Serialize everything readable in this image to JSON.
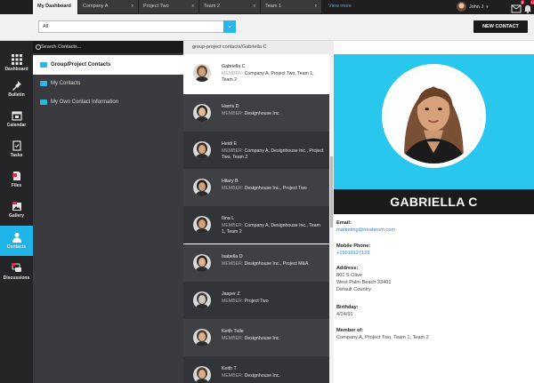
{
  "tabs": [
    {
      "label": "My Dashboard",
      "active": true
    },
    {
      "label": "Company A",
      "active": false
    },
    {
      "label": "Project Two",
      "active": false
    },
    {
      "label": "Team 2",
      "active": false
    },
    {
      "label": "Team 1",
      "active": false
    }
  ],
  "tab_close": "x",
  "view_more": "View more",
  "user_name": "John J",
  "mail_badge": "8",
  "notif_badge": "10",
  "filter_value": "All",
  "new_contact_label": "NEW CONTACT",
  "sidebar": [
    {
      "label": "Dashboard",
      "icon": "grid-icon"
    },
    {
      "label": "Bulletin",
      "icon": "pin-icon"
    },
    {
      "label": "Calendar",
      "icon": "calendar-icon"
    },
    {
      "label": "Tasks",
      "icon": "checklist-icon"
    },
    {
      "label": "Files",
      "icon": "file-icon"
    },
    {
      "label": "Gallery",
      "icon": "image-icon"
    },
    {
      "label": "Contacts",
      "icon": "person-icon",
      "active": true
    },
    {
      "label": "Discussions",
      "icon": "chat-icon"
    }
  ],
  "search_placeholder": "Search Contacts...",
  "groups": [
    {
      "label": "Group/Project Contacts",
      "active": true
    },
    {
      "label": "My Contacts",
      "active": false
    },
    {
      "label": "My Own Contact Information",
      "active": false
    }
  ],
  "breadcrumb": "group-project contacts/Gabriella C",
  "member_prefix": "MEMBER:",
  "contacts": [
    {
      "name": "Gabriella C",
      "member": "Company A, Project Two, Team 1, Team 2",
      "active": true,
      "face": "#cf9e7a",
      "hair": "#6d4a33"
    },
    {
      "name": "Harris D",
      "member": "Designhouse Inc.",
      "face": "#e1b894",
      "hair": "#2a2421"
    },
    {
      "name": "Heidi E",
      "member": "Company A, Designhouse Inc., Project Two, Team 2",
      "face": "#d7a681",
      "hair": "#3a2a22"
    },
    {
      "name": "Hilary B",
      "member": "Designhouse Inc., Project Two",
      "face": "#caa07c",
      "hair": "#1f1a18"
    },
    {
      "name": "Ilina L",
      "member": "Company A, Designhouse Inc., Team 1, Team 2",
      "face": "#d0a27c",
      "hair": "#3b2b22"
    },
    {
      "name": "Isabella D",
      "member": "Designhouse Inc., Project M&A",
      "face": "#e2b38f",
      "hair": "#2b211c"
    },
    {
      "name": "Jasper Z",
      "member": "Project Two",
      "face": "#cfc6bd",
      "hair": "#3d3d3d"
    },
    {
      "name": "Keith Tulle",
      "member": "Designhouse Inc.",
      "face": "#dcae8a",
      "hair": "#4a3a2f"
    },
    {
      "name": "Keith T",
      "member": "Designhouse Inc.",
      "face": "#dcae8a",
      "hair": "#4a3a2f"
    }
  ],
  "profile": {
    "name": "GABRIELLA C",
    "email_label": "Email:",
    "email": "marketing@ntrabeom.com",
    "phone_label": "Mobile Phone:",
    "phone": "+15616127123",
    "address_label": "Address:",
    "address_lines": [
      "801 S Olive",
      "West Palm Beach 33401",
      "Default Country"
    ],
    "birthday_label": "Birthday:",
    "birthday": "4/24/91",
    "member_label": "Member of:",
    "member_of": "Company A, Project Two, Team 1, Team 2"
  },
  "colors": {
    "accent": "#29c6ee",
    "dark": "#252528",
    "link": "#2a7fd4",
    "badge": "#e2274a"
  }
}
